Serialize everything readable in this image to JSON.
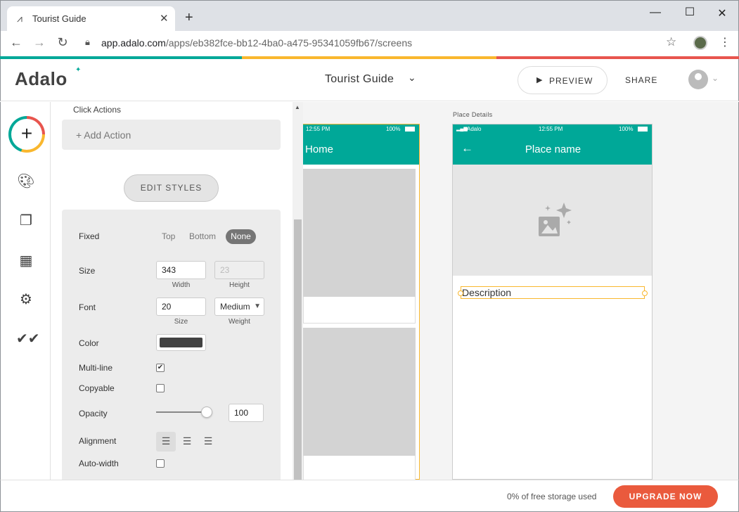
{
  "browser": {
    "tab_title": "Tourist Guide",
    "url_host": "app.adalo.com",
    "url_path": "/apps/eb382fce-bb12-4ba0-a475-95341059fb67/screens",
    "icons": {
      "favicon": "adalo-favicon-icon",
      "close": "close-icon",
      "new_tab": "plus-icon",
      "back": "arrow-left-icon",
      "forward": "arrow-right-icon",
      "reload": "reload-icon",
      "lock": "lock-icon",
      "bookmark": "star-icon",
      "menu": "kebab-icon"
    }
  },
  "app": {
    "logo": "Adalo",
    "title": "Tourist Guide",
    "preview_label": "PREVIEW",
    "share_label": "SHARE",
    "brand_colors": {
      "teal": "#00a898",
      "yellow": "#f9b72e",
      "red": "#e8554e"
    }
  },
  "rail": {
    "items": [
      "add-icon",
      "palette-icon",
      "screens-icon",
      "database-icon",
      "settings-icon",
      "publish-check-icon"
    ]
  },
  "panel": {
    "click_actions_label": "Click Actions",
    "add_action_label": "+ Add Action",
    "edit_styles_label": "EDIT STYLES",
    "fixed": {
      "label": "Fixed",
      "options": [
        "Top",
        "Bottom",
        "None"
      ],
      "selected": "None"
    },
    "size": {
      "label": "Size",
      "width": "343",
      "height": "23",
      "width_caption": "Width",
      "height_caption": "Height"
    },
    "font": {
      "label": "Font",
      "size": "20",
      "weight": "Medium",
      "size_caption": "Size",
      "weight_caption": "Weight"
    },
    "color": {
      "label": "Color",
      "value": "#424242"
    },
    "multiline": {
      "label": "Multi-line",
      "checked": true
    },
    "copyable": {
      "label": "Copyable",
      "checked": false
    },
    "opacity": {
      "label": "Opacity",
      "value": "100"
    },
    "alignment": {
      "label": "Alignment",
      "selected": "left"
    },
    "auto_width": {
      "label": "Auto-width",
      "checked": false
    }
  },
  "canvas": {
    "screen1": {
      "time": "12:55 PM",
      "battery": "100%",
      "title": "Home"
    },
    "screen2": {
      "label": "Place Details",
      "carrier": "Adalo",
      "time": "12:55 PM",
      "battery": "100%",
      "title": "Place name",
      "description": "Description"
    }
  },
  "footer": {
    "storage_text": "0% of free storage used",
    "upgrade_label": "UPGRADE NOW"
  }
}
